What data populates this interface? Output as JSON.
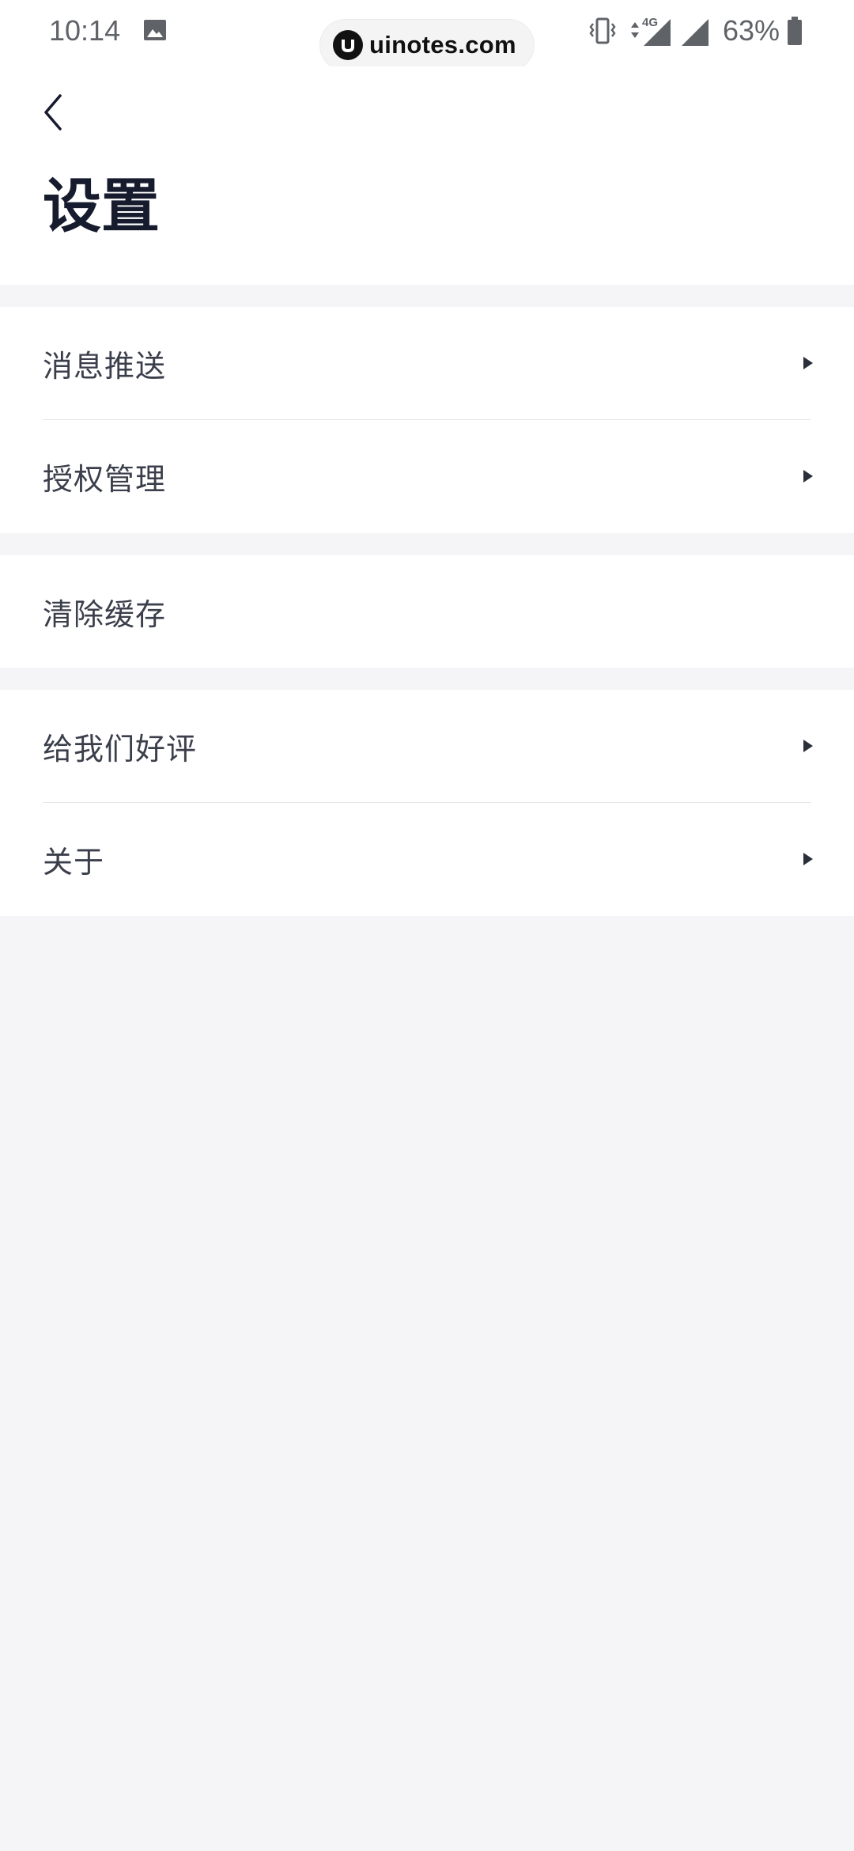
{
  "status_bar": {
    "time": "10:14",
    "network": "4G",
    "battery": "63%"
  },
  "watermark": {
    "text": "uinotes.com"
  },
  "header": {
    "title": "设置",
    "back_icon": "chevron-left-icon"
  },
  "groups": [
    {
      "items": [
        {
          "label": "消息推送",
          "has_arrow": true
        },
        {
          "label": "授权管理",
          "has_arrow": true
        }
      ]
    },
    {
      "items": [
        {
          "label": "清除缓存",
          "has_arrow": false
        }
      ]
    },
    {
      "items": [
        {
          "label": "给我们好评",
          "has_arrow": true
        },
        {
          "label": "关于",
          "has_arrow": true
        }
      ]
    }
  ],
  "colors": {
    "background": "#f5f5f7",
    "surface": "#ffffff",
    "title": "#161b2e",
    "text": "#3a3f4b",
    "divider": "#e6e7eb"
  }
}
